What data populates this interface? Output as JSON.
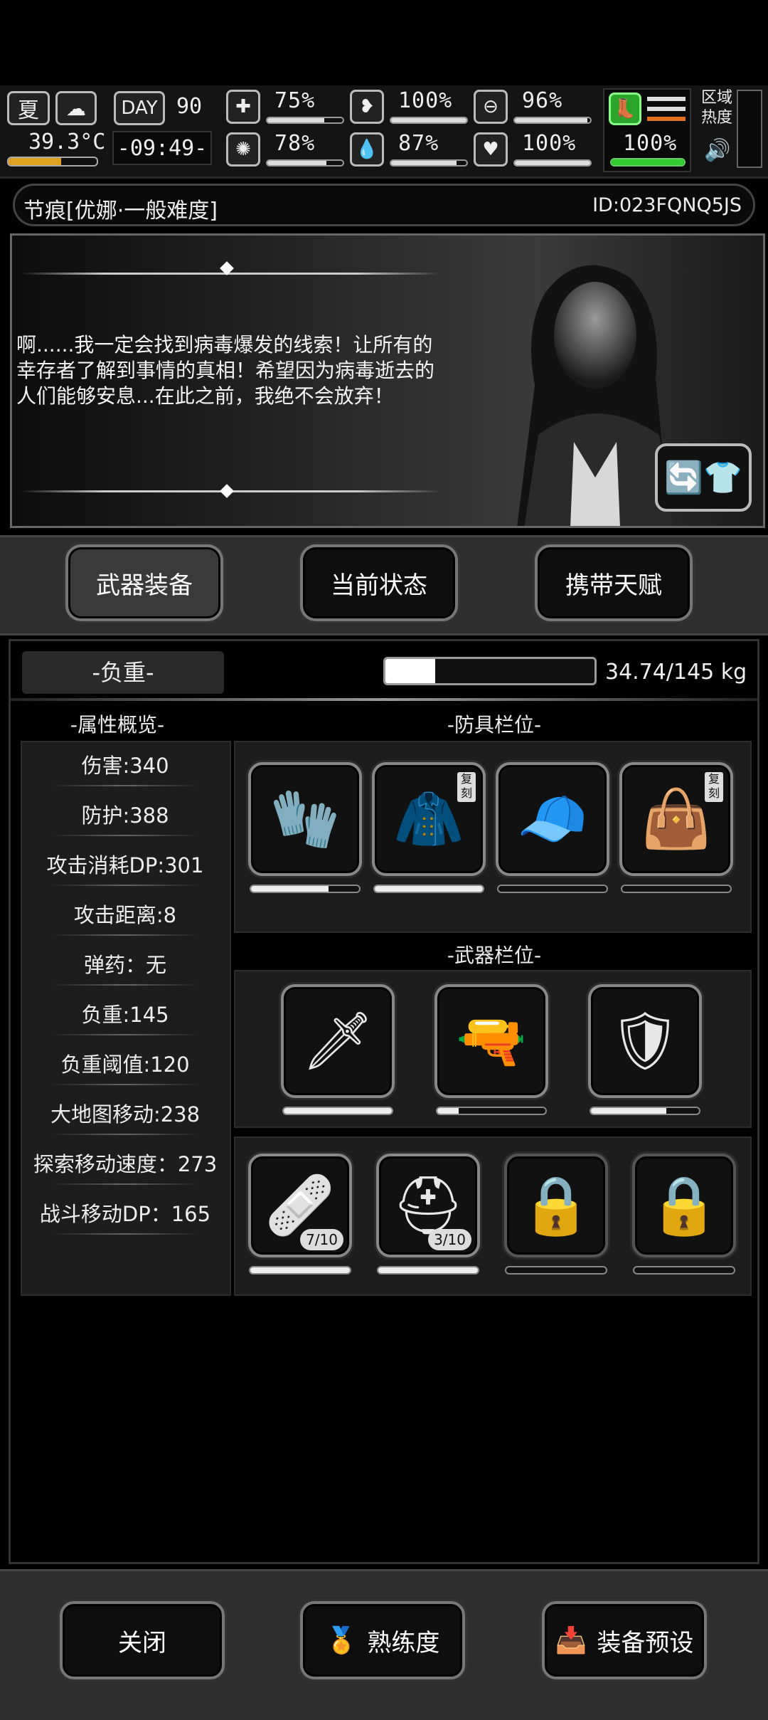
{
  "hud": {
    "season": "夏",
    "temperature": "39.3°C",
    "day_label": "DAY",
    "day_number": "90",
    "clock": "-09:49-",
    "stats": [
      {
        "icon": "medkit-icon",
        "value": "75%",
        "level": 0.75
      },
      {
        "icon": "stomach-icon",
        "value": "100%",
        "level": 1.0
      },
      {
        "icon": "pill-icon",
        "value": "96%",
        "level": 0.96
      },
      {
        "icon": "brain-icon",
        "value": "78%",
        "level": 0.78
      },
      {
        "icon": "water-drop-icon",
        "value": "87%",
        "level": 0.87
      },
      {
        "icon": "heart-icon",
        "value": "100%",
        "level": 1.0
      }
    ],
    "stamina_value": "100%",
    "stamina_level": 1.0,
    "zone_label_1": "区域",
    "zone_label_2": "热度"
  },
  "title_strip": {
    "name": "节痕[优娜·一般难度]",
    "id": "ID:023FQNQ5JS"
  },
  "story": {
    "text": "啊......我一定会找到病毒爆发的线索！让所有的幸存者了解到事情的真相！希望因为病毒逝去的人们能够安息...在此之前，我绝不会放弃！"
  },
  "tabs": [
    {
      "label": "武器装备",
      "active": true
    },
    {
      "label": "当前状态",
      "active": false
    },
    {
      "label": "携带天赋",
      "active": false
    }
  ],
  "load": {
    "label": "-负重-",
    "value_text": "34.74/145 kg",
    "fraction": 0.2396
  },
  "attributes": {
    "title": "-属性概览-",
    "items": [
      "伤害:340",
      "防护:388",
      "攻击消耗DP:301",
      "攻击距离:8",
      "弹药：无",
      "负重:145",
      "负重阈值:120",
      "大地图移动:238",
      "探索移动速度：273",
      "战斗移动DP：165"
    ]
  },
  "armor": {
    "title": "-防具栏位-",
    "slots": [
      {
        "icon": "gloves-icon",
        "durability": 0.72,
        "tag": ""
      },
      {
        "icon": "coat-icon",
        "durability": 1.0,
        "tag": "复刻"
      },
      {
        "icon": "visor-cap-icon",
        "durability": 0.0,
        "tag": ""
      },
      {
        "icon": "duffel-bag-icon",
        "durability": 0.0,
        "tag": "复刻"
      }
    ]
  },
  "weapons": {
    "title": "-武器栏位-",
    "slots": [
      {
        "icon": "machete-icon",
        "durability": 1.0
      },
      {
        "icon": "rocket-launcher-icon",
        "durability": 0.2
      },
      {
        "icon": "shield-icon",
        "durability": 0.7
      }
    ]
  },
  "items": {
    "slots": [
      {
        "icon": "bandage-pack-icon",
        "count": "7/10",
        "durability": 1.0,
        "locked": false
      },
      {
        "icon": "net-helmet-icon",
        "count": "3/10",
        "durability": 1.0,
        "locked": false
      },
      {
        "icon": "lock-icon",
        "count": "",
        "durability": 0.0,
        "locked": true
      },
      {
        "icon": "lock-icon",
        "count": "",
        "durability": 0.0,
        "locked": true
      }
    ]
  },
  "bottom": {
    "close": "关闭",
    "proficiency": "熟练度",
    "preset": "装备预设"
  }
}
